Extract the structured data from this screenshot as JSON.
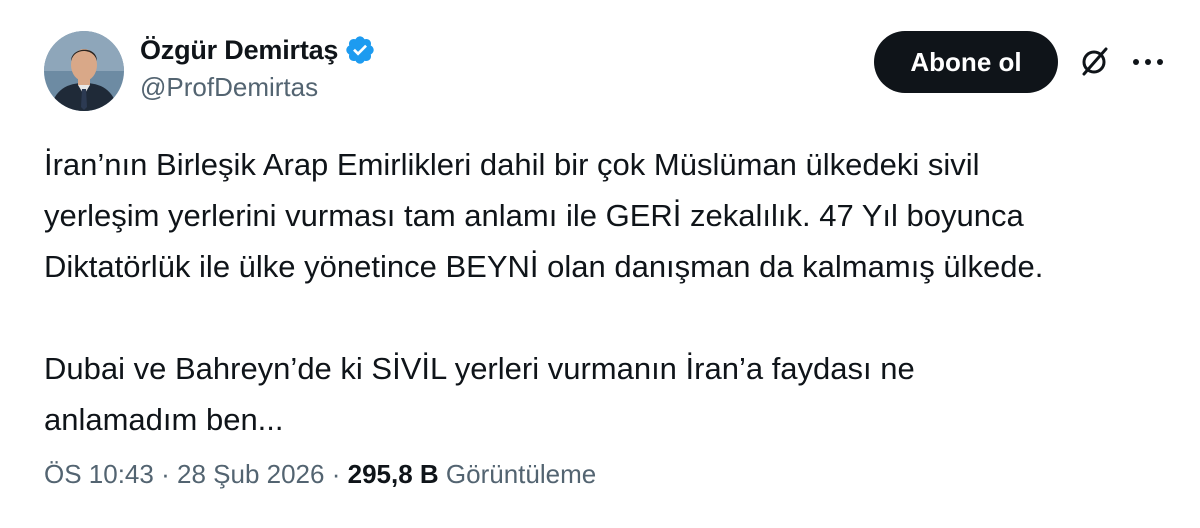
{
  "author": {
    "display_name": "Özgür Demirtaş",
    "handle": "@ProfDemirtas",
    "verified": true
  },
  "actions": {
    "follow_label": "Abone ol"
  },
  "icons": {
    "verified": "verified-badge-icon",
    "grok": "grok-icon",
    "more": "more-dots-icon"
  },
  "tweet": {
    "lines": [
      "İran’nın Birleşik Arap Emirlikleri dahil bir çok Müslüman ülkedeki sivil",
      "yerleşim yerlerini vurması tam anlamı ile GERİ zekalılık. 47 Yıl boyunca",
      "Diktatörlük ile ülke yönetince BEYNİ olan danışman da kalmamış ülkede.",
      "Dubai ve Bahreyn’de ki SİVİL yerleri vurmanın İran’a faydası ne",
      "anlamadım ben..."
    ]
  },
  "meta": {
    "time": "ÖS 10:43",
    "separator": "·",
    "date": "28 Şub 2026",
    "views_count": "295,8 B",
    "views_label": "Görüntüleme"
  },
  "colors": {
    "text": "#0f1419",
    "secondary": "#536471",
    "verified": "#1d9bf0",
    "button_bg": "#0f1419"
  }
}
